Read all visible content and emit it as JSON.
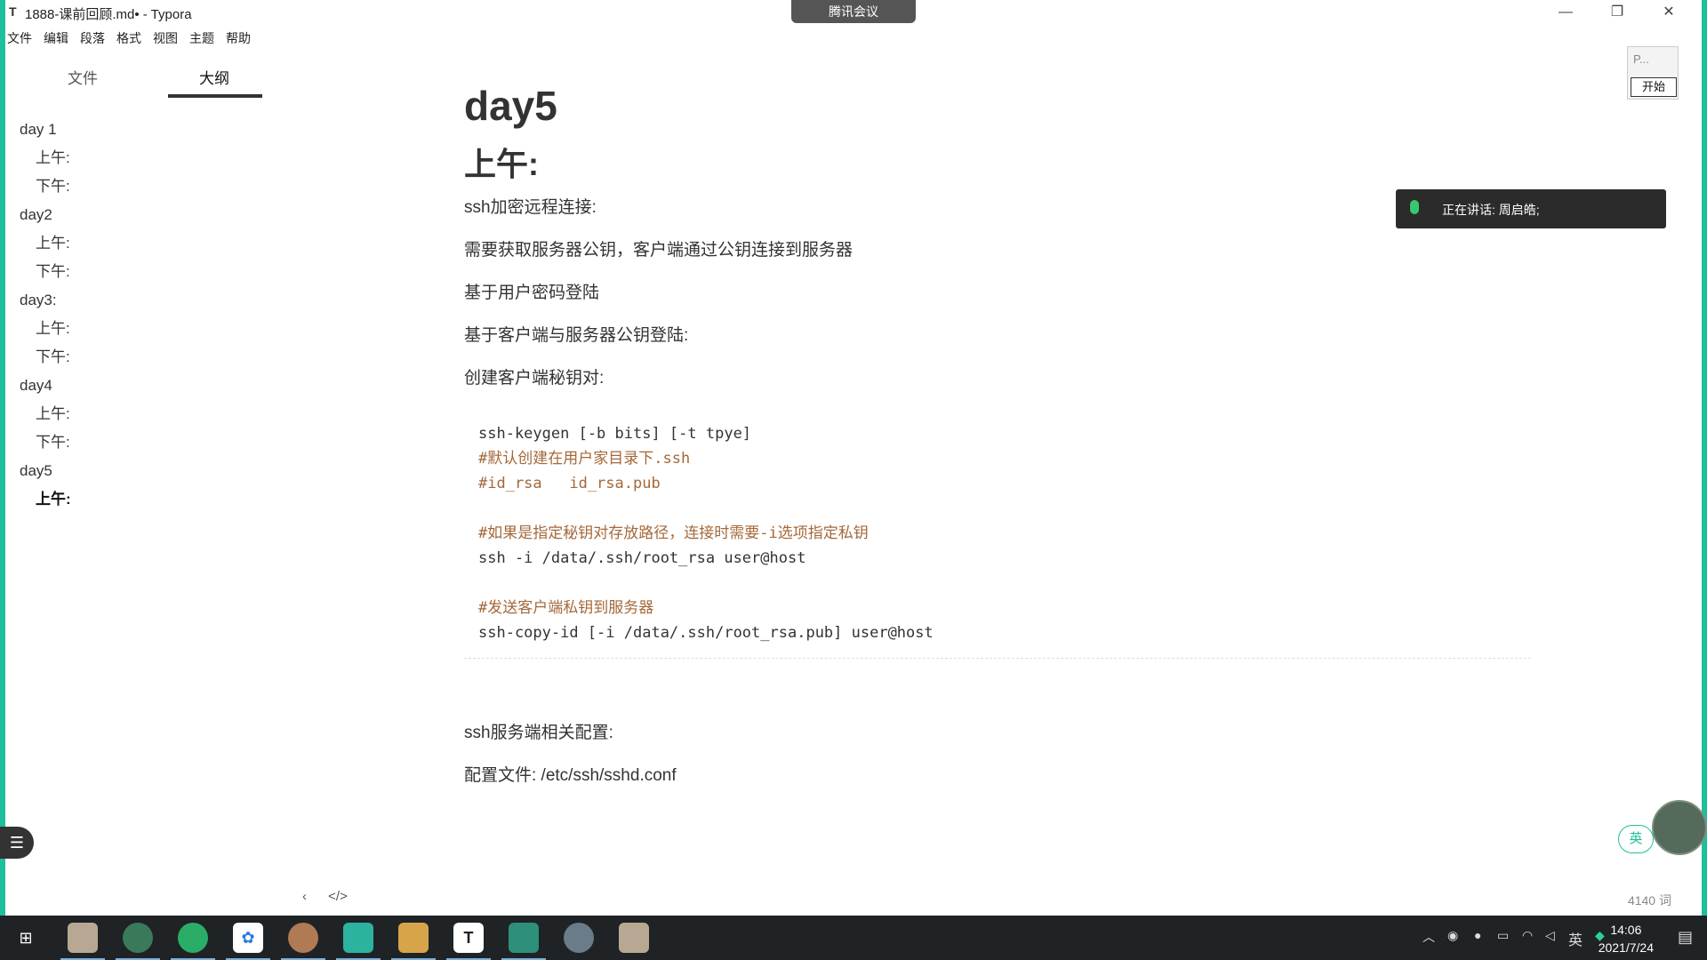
{
  "window": {
    "app_icon": "T",
    "title": "1888-课前回顾.md• - Typora",
    "minimize": "—",
    "restore": "❐",
    "close": "✕"
  },
  "meeting": {
    "badge": "腾讯会议"
  },
  "menu": [
    "文件",
    "编辑",
    "段落",
    "格式",
    "视图",
    "主题",
    "帮助"
  ],
  "sidebar": {
    "tabs": {
      "files": "文件",
      "outline": "大纲"
    },
    "outline": [
      {
        "label": "day 1",
        "level": 1
      },
      {
        "label": "上午:",
        "level": 2
      },
      {
        "label": "下午:",
        "level": 2
      },
      {
        "label": "day2",
        "level": 1
      },
      {
        "label": "上午:",
        "level": 2
      },
      {
        "label": "下午:",
        "level": 2
      },
      {
        "label": "day3:",
        "level": 1
      },
      {
        "label": "上午:",
        "level": 2
      },
      {
        "label": "下午:",
        "level": 2
      },
      {
        "label": "day4",
        "level": 1
      },
      {
        "label": "上午:",
        "level": 2
      },
      {
        "label": "下午:",
        "level": 2
      },
      {
        "label": "day5",
        "level": 1
      },
      {
        "label": "上午:",
        "level": 2,
        "active": true
      }
    ]
  },
  "doc": {
    "h1": "day5",
    "h2": "上午:",
    "paragraphs": [
      "ssh加密远程连接:",
      "需要获取服务器公钥，客户端通过公钥连接到服务器",
      "基于用户密码登陆",
      "基于客户端与服务器公钥登陆:",
      "创建客户端秘钥对:"
    ],
    "code": [
      {
        "text": "ssh-keygen [-b bits] [-t tpye]",
        "comment": false
      },
      {
        "text": "#默认创建在用户家目录下.ssh",
        "comment": true
      },
      {
        "text": "#id_rsa   id_rsa.pub",
        "comment": true
      },
      {
        "text": "",
        "comment": false
      },
      {
        "text": "#如果是指定秘钥对存放路径，连接时需要-i选项指定私钥",
        "comment": true
      },
      {
        "text": "ssh -i /data/.ssh/root_rsa user@host",
        "comment": false
      },
      {
        "text": "",
        "comment": false
      },
      {
        "text": "#发送客户端私钥到服务器",
        "comment": true
      },
      {
        "text": "ssh-copy-id [-i /data/.ssh/root_rsa.pub] user@host",
        "comment": false
      }
    ],
    "after_code": [
      "ssh服务端相关配置:",
      "配置文件: /etc/ssh/sshd.conf"
    ]
  },
  "speaking": {
    "text": "正在讲话: 周启皓;"
  },
  "mini_meeting": {
    "label": "P...",
    "start": "开始"
  },
  "ime_badge": "英",
  "status": {
    "back": "‹",
    "source": "</>",
    "word_count": "4140 词"
  },
  "taskbar": {
    "ime": "英",
    "time": "14:06",
    "date": "2021/7/24"
  }
}
